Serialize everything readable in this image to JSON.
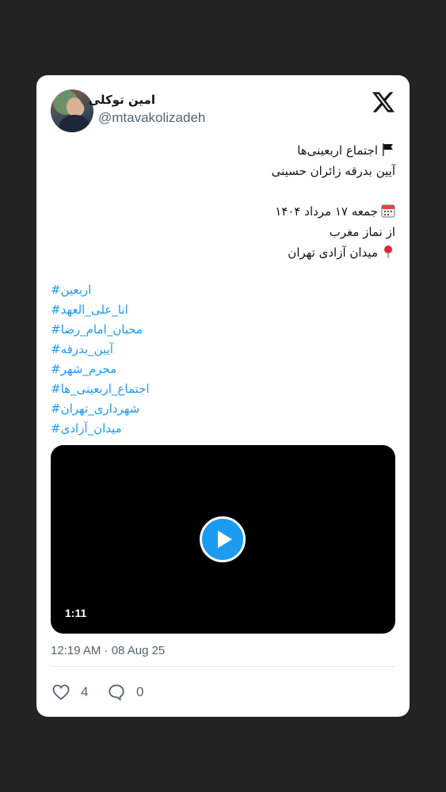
{
  "author": {
    "name": "امین توکلی",
    "handle": "@mtavakolizadeh"
  },
  "icons": {
    "logo": "x-logo-icon",
    "flag": "black-flag-icon",
    "calendar": "calendar-icon",
    "pin": "round-pushpin-icon",
    "play": "play-icon",
    "like": "heart-icon",
    "reply": "reply-bubble-icon"
  },
  "colors": {
    "accent": "#1d9bf0",
    "text": "#0f1419",
    "muted": "#536471",
    "background": "#232323"
  },
  "tweet": {
    "lines": [
      "اجتماع اربعینی‌ها",
      "آیین بدرقه زائران حسینی",
      "جمعه ۱۷ مرداد ۱۴۰۴",
      "از نماز مغرب",
      "میدان آزادی تهران"
    ],
    "hashtags": [
      "#اربعین",
      "#انا_علی_العهد",
      "#محبان_امام_رضا",
      "#آیین_بدرقه",
      "#محرم_شهر",
      "#اجتماع_اربعینی_ها",
      "#شهرداری_تهران",
      "#میدان_آزادی"
    ]
  },
  "video": {
    "duration": "1:11"
  },
  "meta": {
    "timestamp": "12:19 AM · 08 Aug 25"
  },
  "stats": {
    "likes": "4",
    "replies": "0"
  }
}
